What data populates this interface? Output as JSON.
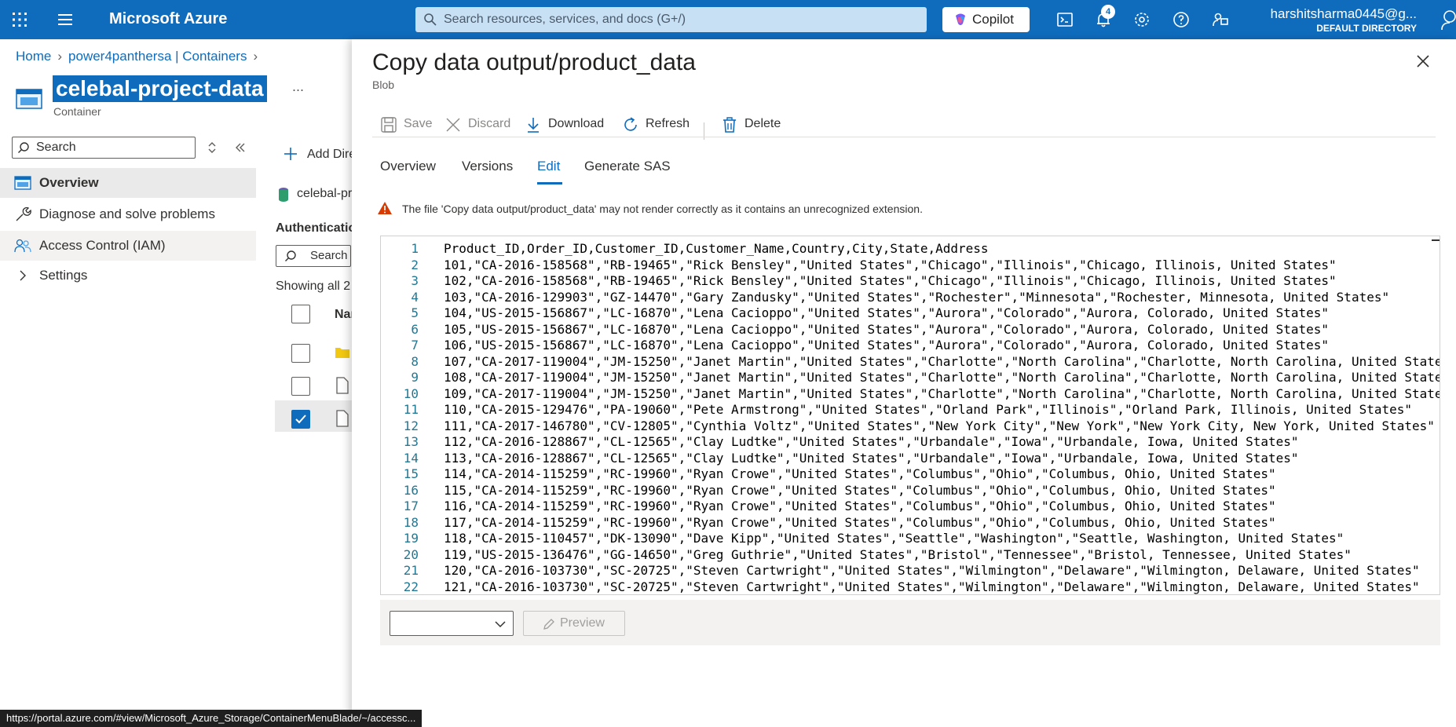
{
  "topbar": {
    "brand": "Microsoft Azure",
    "search_placeholder": "Search resources, services, and docs (G+/)",
    "copilot_label": "Copilot",
    "notification_count": "4",
    "account_user": "harshitsharma0445@g...",
    "account_directory": "DEFAULT DIRECTORY",
    "bg_color": "#0f6cbd"
  },
  "breadcrumb": {
    "home": "Home",
    "storage": "power4panthersa | Containers"
  },
  "container": {
    "title": "celebal-project-data",
    "more": "...",
    "subtitle": "Container"
  },
  "leftnav": {
    "search_placeholder": "Search",
    "items": [
      {
        "label": "Overview",
        "icon": "container-icon"
      },
      {
        "label": "Diagnose and solve problems",
        "icon": "wrench-icon"
      },
      {
        "label": "Access Control (IAM)",
        "icon": "people-icon"
      },
      {
        "label": "Settings",
        "icon": "chevron-right-icon"
      }
    ]
  },
  "middle": {
    "add_directory": "Add Dire",
    "path": "celebal-pr",
    "auth_label": "Authenticatio",
    "search_placeholder": "Search",
    "showing": "Showing all 2",
    "name_header": "Nar"
  },
  "panel": {
    "title": "Copy data output/product_data",
    "subtitle": "Blob",
    "toolbar": {
      "save": "Save",
      "discard": "Discard",
      "download": "Download",
      "refresh": "Refresh",
      "delete": "Delete"
    },
    "tabs": [
      "Overview",
      "Versions",
      "Edit",
      "Generate SAS"
    ],
    "active_tab": "Edit",
    "warning": "The file 'Copy data output/product_data' may not render correctly as it contains an unrecognized extension.",
    "lines": [
      "Product_ID,Order_ID,Customer_ID,Customer_Name,Country,City,State,Address",
      "101,\"CA-2016-158568\",\"RB-19465\",\"Rick Bensley\",\"United States\",\"Chicago\",\"Illinois\",\"Chicago, Illinois, United States\"",
      "102,\"CA-2016-158568\",\"RB-19465\",\"Rick Bensley\",\"United States\",\"Chicago\",\"Illinois\",\"Chicago, Illinois, United States\"",
      "103,\"CA-2016-129903\",\"GZ-14470\",\"Gary Zandusky\",\"United States\",\"Rochester\",\"Minnesota\",\"Rochester, Minnesota, United States\"",
      "104,\"US-2015-156867\",\"LC-16870\",\"Lena Cacioppo\",\"United States\",\"Aurora\",\"Colorado\",\"Aurora, Colorado, United States\"",
      "105,\"US-2015-156867\",\"LC-16870\",\"Lena Cacioppo\",\"United States\",\"Aurora\",\"Colorado\",\"Aurora, Colorado, United States\"",
      "106,\"US-2015-156867\",\"LC-16870\",\"Lena Cacioppo\",\"United States\",\"Aurora\",\"Colorado\",\"Aurora, Colorado, United States\"",
      "107,\"CA-2017-119004\",\"JM-15250\",\"Janet Martin\",\"United States\",\"Charlotte\",\"North Carolina\",\"Charlotte, North Carolina, United State",
      "108,\"CA-2017-119004\",\"JM-15250\",\"Janet Martin\",\"United States\",\"Charlotte\",\"North Carolina\",\"Charlotte, North Carolina, United State",
      "109,\"CA-2017-119004\",\"JM-15250\",\"Janet Martin\",\"United States\",\"Charlotte\",\"North Carolina\",\"Charlotte, North Carolina, United State",
      "110,\"CA-2015-129476\",\"PA-19060\",\"Pete Armstrong\",\"United States\",\"Orland Park\",\"Illinois\",\"Orland Park, Illinois, United States\"",
      "111,\"CA-2017-146780\",\"CV-12805\",\"Cynthia Voltz\",\"United States\",\"New York City\",\"New York\",\"New York City, New York, United States\"",
      "112,\"CA-2016-128867\",\"CL-12565\",\"Clay Ludtke\",\"United States\",\"Urbandale\",\"Iowa\",\"Urbandale, Iowa, United States\"",
      "113,\"CA-2016-128867\",\"CL-12565\",\"Clay Ludtke\",\"United States\",\"Urbandale\",\"Iowa\",\"Urbandale, Iowa, United States\"",
      "114,\"CA-2014-115259\",\"RC-19960\",\"Ryan Crowe\",\"United States\",\"Columbus\",\"Ohio\",\"Columbus, Ohio, United States\"",
      "115,\"CA-2014-115259\",\"RC-19960\",\"Ryan Crowe\",\"United States\",\"Columbus\",\"Ohio\",\"Columbus, Ohio, United States\"",
      "116,\"CA-2014-115259\",\"RC-19960\",\"Ryan Crowe\",\"United States\",\"Columbus\",\"Ohio\",\"Columbus, Ohio, United States\"",
      "117,\"CA-2014-115259\",\"RC-19960\",\"Ryan Crowe\",\"United States\",\"Columbus\",\"Ohio\",\"Columbus, Ohio, United States\"",
      "118,\"CA-2015-110457\",\"DK-13090\",\"Dave Kipp\",\"United States\",\"Seattle\",\"Washington\",\"Seattle, Washington, United States\"",
      "119,\"US-2015-136476\",\"GG-14650\",\"Greg Guthrie\",\"United States\",\"Bristol\",\"Tennessee\",\"Bristol, Tennessee, United States\"",
      "120,\"CA-2016-103730\",\"SC-20725\",\"Steven Cartwright\",\"United States\",\"Wilmington\",\"Delaware\",\"Wilmington, Delaware, United States\"",
      "121,\"CA-2016-103730\",\"SC-20725\",\"Steven Cartwright\",\"United States\",\"Wilmington\",\"Delaware\",\"Wilmington, Delaware, United States\""
    ],
    "preview_label": "Preview"
  },
  "status_url": "https://portal.azure.com/#view/Microsoft_Azure_Storage/ContainerMenuBlade/~/accessc..."
}
